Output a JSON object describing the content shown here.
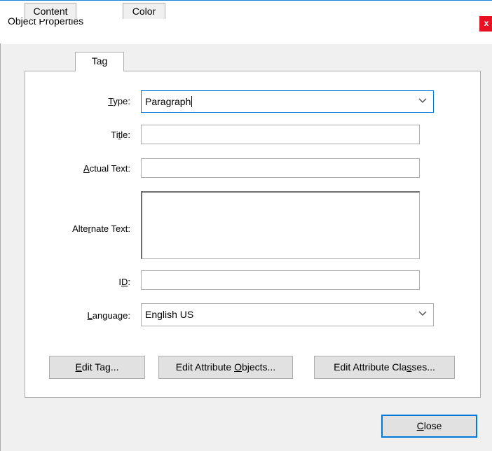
{
  "window": {
    "title": "Object Properties",
    "close_glyph": "x"
  },
  "tabs": [
    {
      "label": "Content",
      "active": false
    },
    {
      "label": "Tag",
      "active": true
    },
    {
      "label": "Color",
      "active": false
    }
  ],
  "form": {
    "type": {
      "label_pre": "",
      "label_u": "T",
      "label_post": "ype:",
      "value": "Paragraph"
    },
    "title": {
      "label_pre": "Ti",
      "label_u": "t",
      "label_post": "le:",
      "value": ""
    },
    "actual_text": {
      "label_pre": "",
      "label_u": "A",
      "label_post": "ctual Text:",
      "value": ""
    },
    "alternate_text": {
      "label_pre": "Alte",
      "label_u": "r",
      "label_post": "nate Text:",
      "value": ""
    },
    "id": {
      "label_pre": "I",
      "label_u": "D",
      "label_post": ":",
      "value": ""
    },
    "language": {
      "label_pre": "",
      "label_u": "L",
      "label_post": "anguage:",
      "value": "English US"
    }
  },
  "buttons": {
    "edit_tag": {
      "pre": "",
      "u": "E",
      "post": "dit Tag..."
    },
    "edit_attribute_objects": {
      "pre": "Edit Attribute ",
      "u": "O",
      "post": "bjects..."
    },
    "edit_attribute_classes": {
      "pre": "Edit Attribute Cla",
      "u": "s",
      "post": "ses..."
    },
    "close": {
      "pre": "",
      "u": "C",
      "post": "lose"
    }
  },
  "icons": {
    "dropdown": "chevron-down-icon",
    "close": "close-icon"
  },
  "colors": {
    "focus_border": "#0078d7",
    "close_red": "#e81123"
  }
}
